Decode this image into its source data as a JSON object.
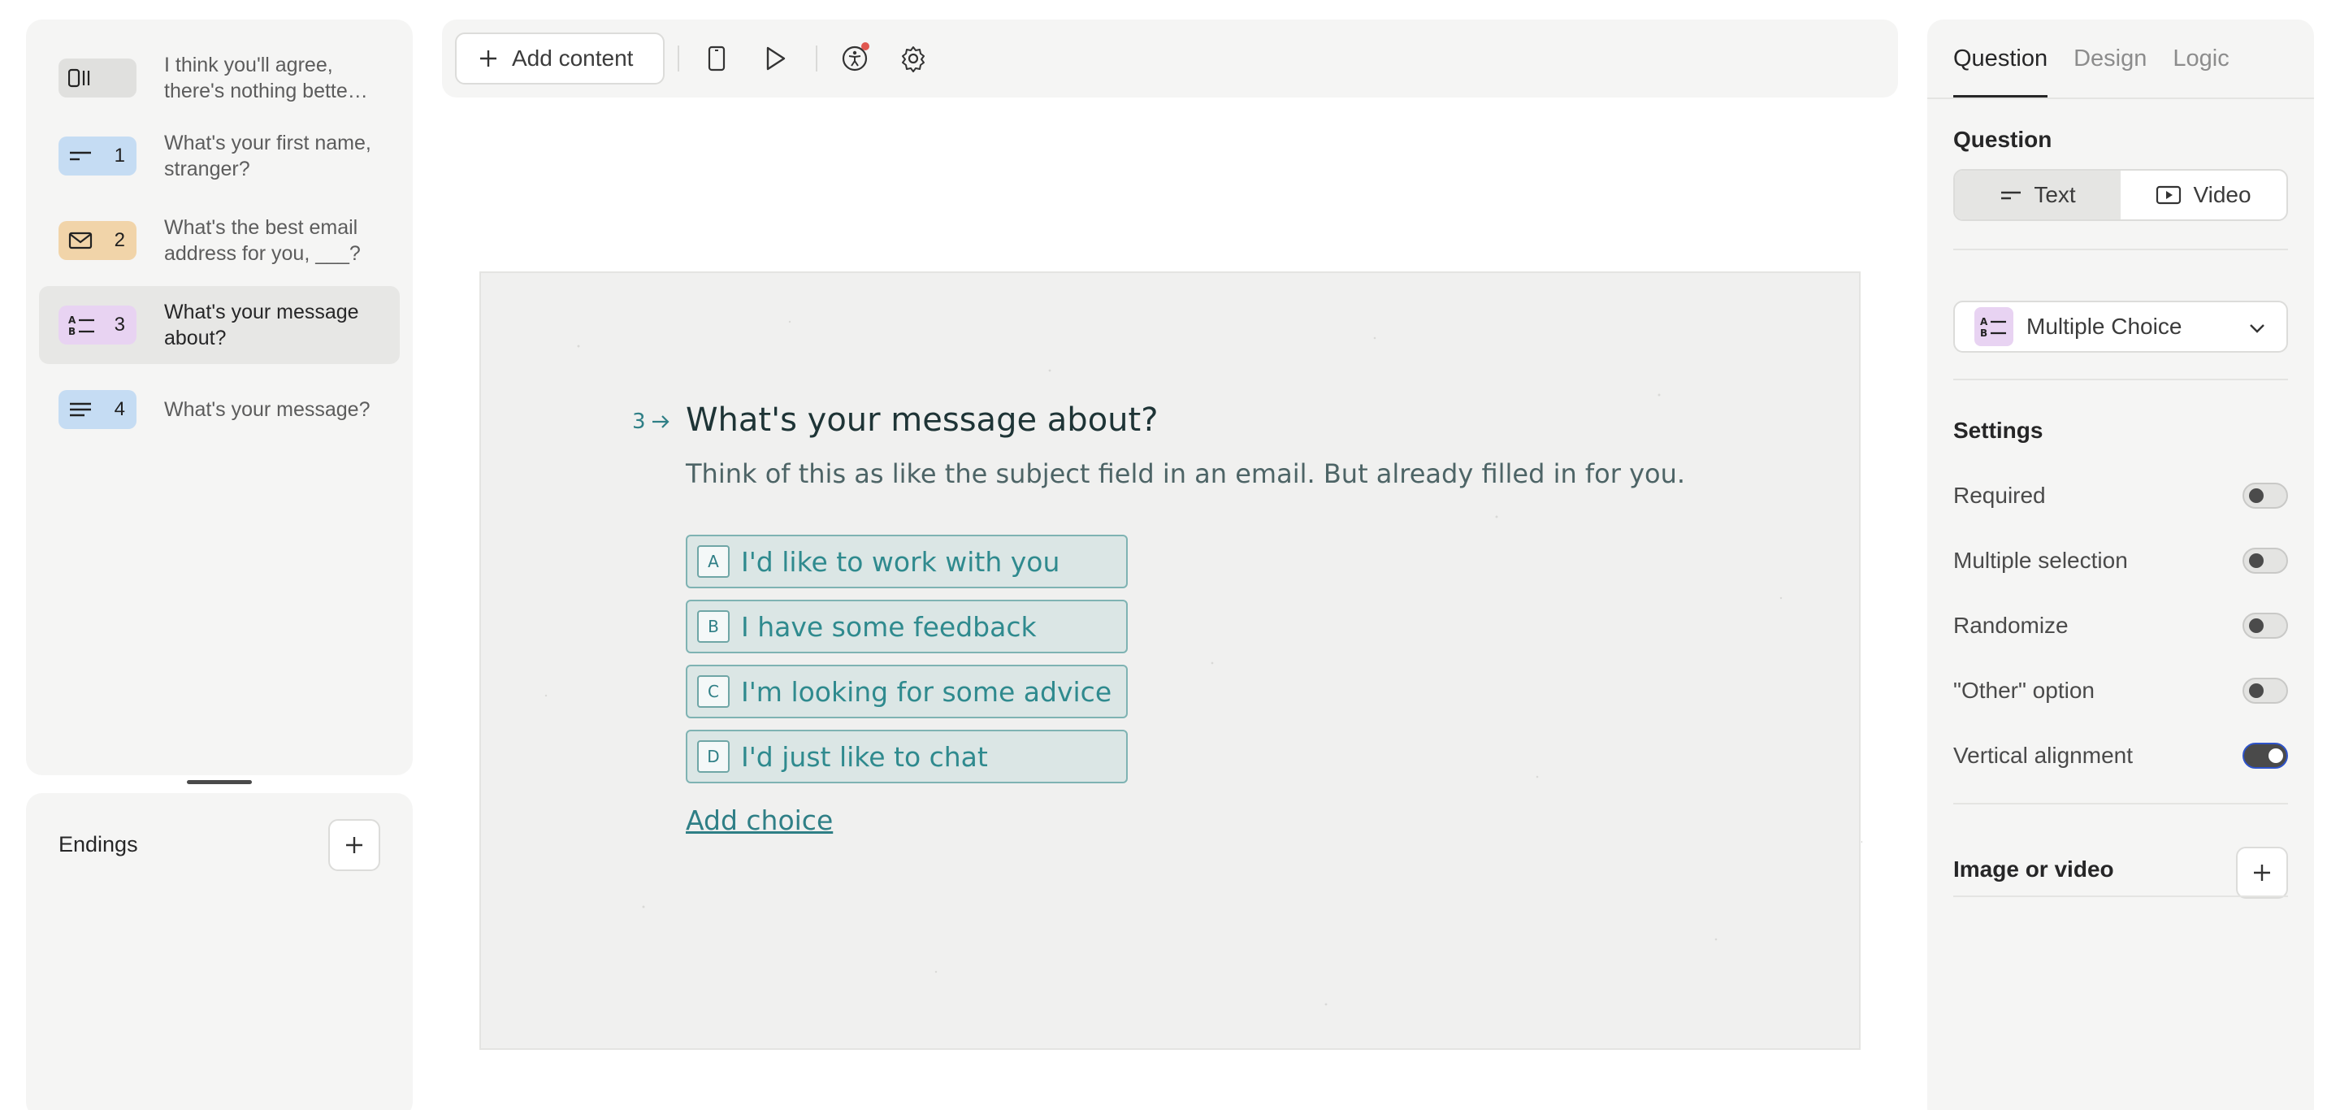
{
  "sidebar": {
    "items": [
      {
        "icon": "statement-icon",
        "number": "",
        "label": "I think you'll agree, there's nothing bette…",
        "color": "#e0e0de"
      },
      {
        "icon": "short-text-icon",
        "number": "1",
        "label": "What's your first name, stranger?",
        "color": "#c5dcf3"
      },
      {
        "icon": "email-icon",
        "number": "2",
        "label": "What's the best email address for you, ___?",
        "color": "#f1d4a9"
      },
      {
        "icon": "multiple-choice-icon",
        "number": "3",
        "label": "What's your message about?",
        "color": "#e8d3f2"
      },
      {
        "icon": "long-text-icon",
        "number": "4",
        "label": "What's your message?",
        "color": "#c5dcf3"
      }
    ],
    "active_index": 3
  },
  "endings": {
    "title": "Endings",
    "add_icon": "plus-icon"
  },
  "toolbar": {
    "add_content_label": "Add content",
    "icons": [
      "mobile-preview-icon",
      "play-icon",
      "accessibility-icon",
      "settings-gear-icon"
    ]
  },
  "canvas": {
    "question_number": "3",
    "question_title": "What's your message about?",
    "question_description": "Think of this as like the subject field in an email. But already filled in for you.",
    "choices": [
      {
        "key": "A",
        "label": "I'd like to work with you"
      },
      {
        "key": "B",
        "label": "I have some feedback"
      },
      {
        "key": "C",
        "label": "I'm looking for some advice"
      },
      {
        "key": "D",
        "label": "I'd just like to chat"
      }
    ],
    "add_choice_label": "Add choice",
    "accent_color": "#2f7f86"
  },
  "right_panel": {
    "tabs": [
      "Question",
      "Design",
      "Logic"
    ],
    "active_tab": "Question",
    "question_label": "Question",
    "question_modes": [
      {
        "label": "Text",
        "active": true
      },
      {
        "label": "Video",
        "active": false
      }
    ],
    "question_type": "Multiple Choice",
    "settings_title": "Settings",
    "settings": [
      {
        "label": "Required",
        "on": false
      },
      {
        "label": "Multiple selection",
        "on": false
      },
      {
        "label": "Randomize",
        "on": false
      },
      {
        "label": "\"Other\" option",
        "on": false
      },
      {
        "label": "Vertical alignment",
        "on": true
      }
    ],
    "image_video_label": "Image or video"
  }
}
